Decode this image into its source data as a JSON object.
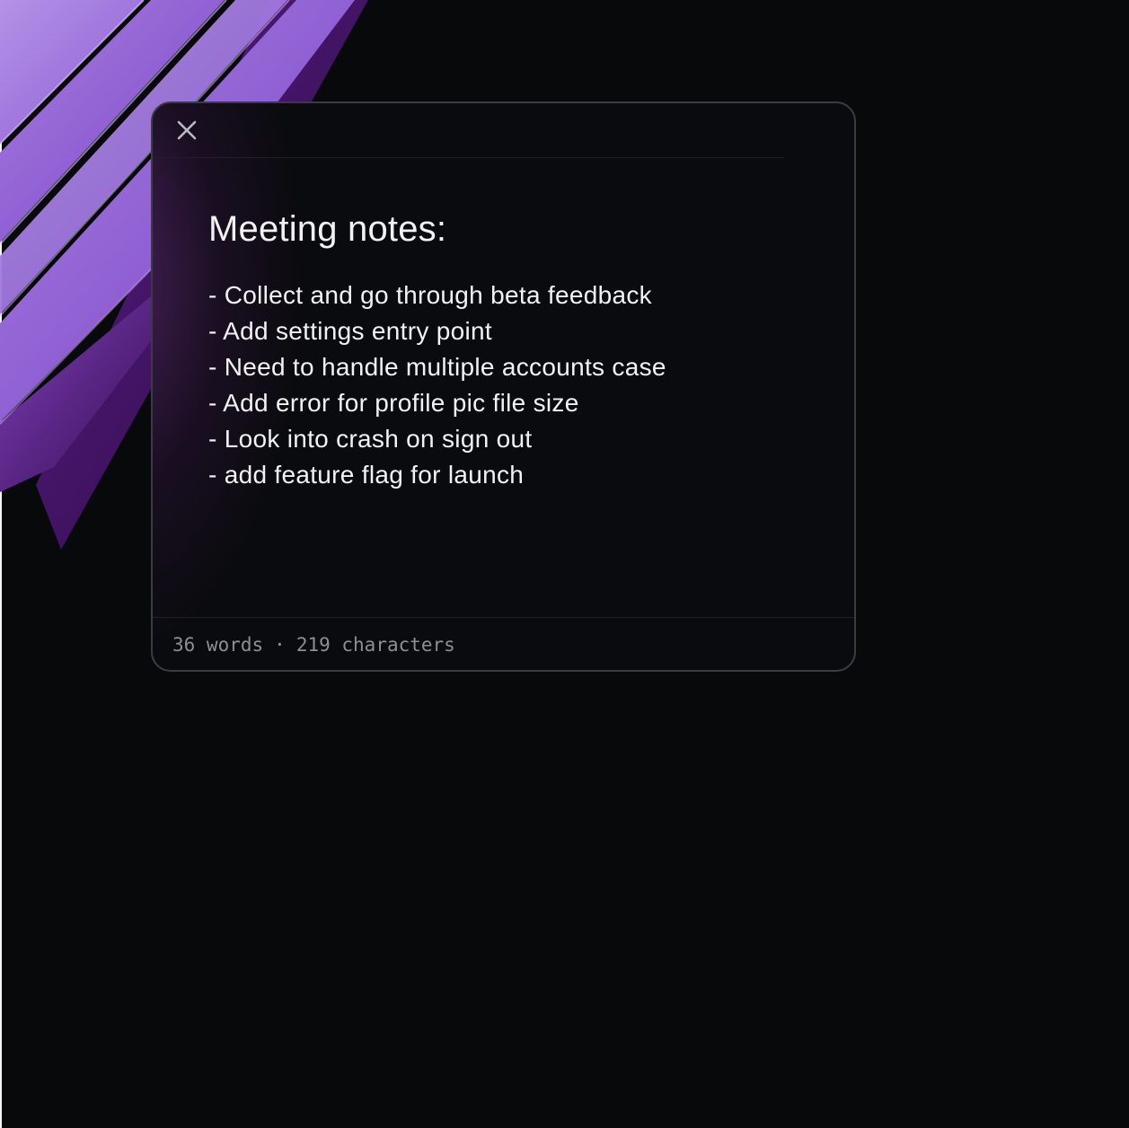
{
  "window": {
    "close_icon": "close-icon"
  },
  "note": {
    "title": "Meeting notes:",
    "lines": [
      "- Collect and go through beta feedback",
      "- Add settings entry point",
      "- Need to handle multiple accounts case",
      "- Add error for profile pic file size",
      "- Look into crash on sign out",
      "- add feature flag for launch"
    ]
  },
  "footer": {
    "words": "36 words",
    "separator": "·",
    "characters": "219 characters"
  },
  "colors": {
    "background": "#08090b",
    "accent": "#9d6fe0",
    "text": "#f2f2f4",
    "muted": "#8d8f96"
  }
}
